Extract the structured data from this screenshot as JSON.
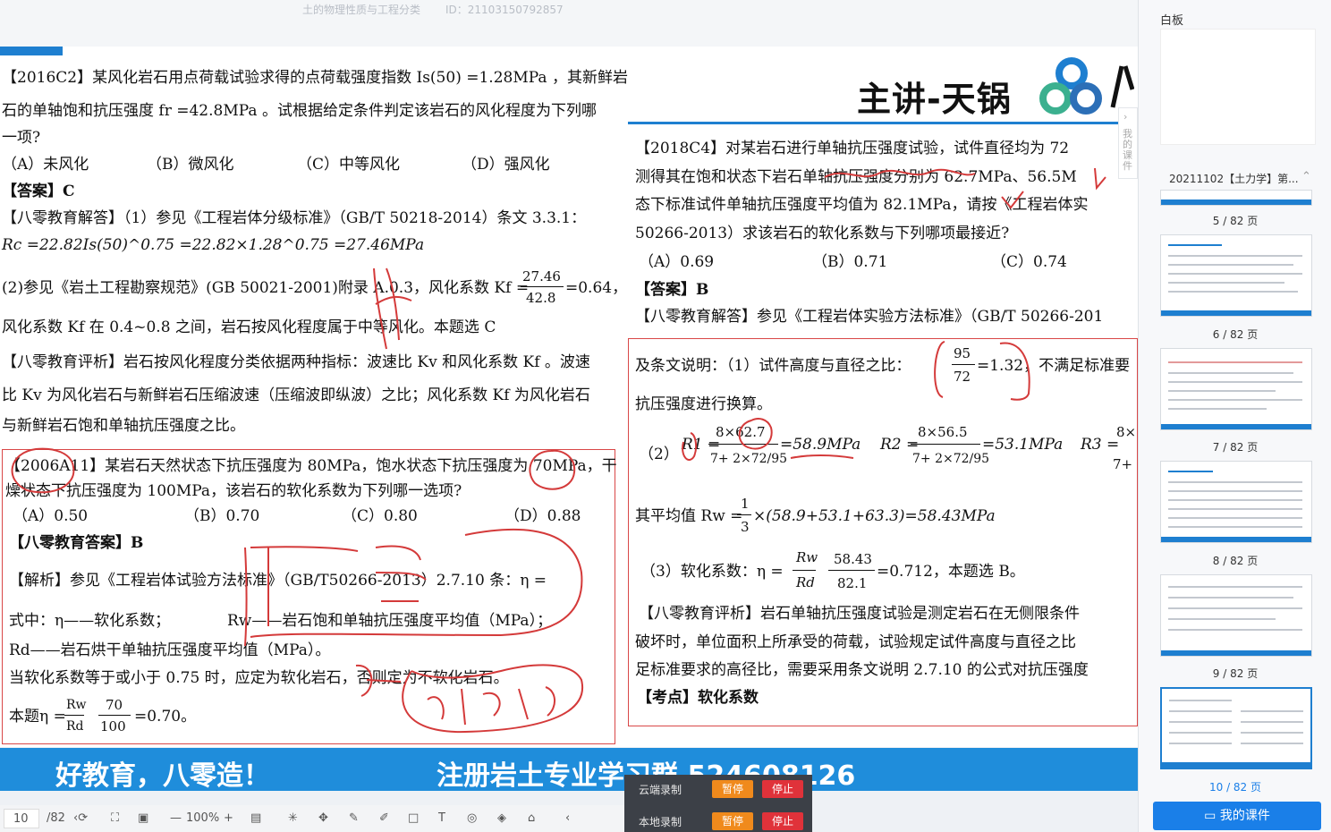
{
  "top": {
    "title": "土的物理性质与工程分类",
    "id": "ID：21103150792857"
  },
  "teacher": "主讲-天锅",
  "left": {
    "q1_l1": "【2016C2】某风化岩石用点荷载试验求得的点荷载强度指数 Is(50) =1.28MPa ，其新鲜岩",
    "q1_l2": "石的单轴饱和抗压强度 fr =42.8MPa 。试根据给定条件判定该岩石的风化程度为下列哪",
    "q1_l3": "一项?",
    "q1_a": "（A）未风化",
    "q1_b": "（B）微风化",
    "q1_c": "（C）中等风化",
    "q1_d": "（D）强风化",
    "q1_ans": "【答案】C",
    "q1_exp1": "【八零教育解答】（1）参见《工程岩体分级标准》（GB/T 50218-2014）条文 3.3.1：",
    "q1_exp2": "Rc =22.82Is(50)^0.75 =22.82×1.28^0.75 =27.46MPa",
    "q1_exp3": "(2)参见《岩土工程勘察规范》(GB 50021-2001)附录 A.0.3，风化系数 Kf =",
    "q1_frac_num": "27.46",
    "q1_frac_den": "42.8",
    "q1_frac_res": "=0.64，",
    "q1_exp4": "风化系数 Kf 在 0.4~0.8 之间，岩石按风化程度属于中等风化。本题选 C",
    "q1_rev1": "【八零教育评析】岩石按风化程度分类依据两种指标：波速比 Kv 和风化系数 Kf 。波速",
    "q1_rev2": "比 Kv 为风化岩石与新鲜岩石压缩波速（压缩波即纵波）之比；风化系数 Kf 为风化岩石",
    "q1_rev3": "与新鲜岩石饱和单轴抗压强度之比。",
    "q2_l1": "【2006A11】某岩石天然状态下抗压强度为 80MPa，饱水状态下抗压强度为 70MPa，干",
    "q2_l2": "燥状态下抗压强度为 100MPa，该岩石的软化系数为下列哪一选项?",
    "q2_a": "（A）0.50",
    "q2_b": "（B）0.70",
    "q2_c": "（C）0.80",
    "q2_d": "（D）0.88",
    "q2_ans": "【八零教育答案】B",
    "q2_exp1": "【解析】参见《工程岩体试验方法标准》（GB/T50266-2013）2.7.10 条：η =",
    "q2_exp2": "式中：η——软化系数；",
    "q2_exp2b": "Rw——岩石饱和单轴抗压强度平均值（MPa）；",
    "q2_exp3": "Rd——岩石烘干单轴抗压强度平均值（MPa）。",
    "q2_exp4": "当软化系数等于或小于 0.75 时，应定为软化岩石，否则定为不软化岩石。",
    "q2_exp5": "本题η =",
    "q2_f1n": "Rw",
    "q2_f1d": "Rd",
    "q2_f2n": "70",
    "q2_f2d": "100",
    "q2_res": "=0.70。"
  },
  "right": {
    "l1": "【2018C4】对某岩石进行单轴抗压强度试验，试件直径均为 72",
    "l2": "测得其在饱和状态下岩石单轴抗压强度分别为 62.7MPa、56.5M",
    "l3": "态下标准试件单轴抗压强度平均值为 82.1MPa，请按《工程岩体实",
    "l4": "50266-2013）求该岩石的软化系数与下列哪项最接近?",
    "a": "（A）0.69",
    "b": "（B）0.71",
    "c": "（C）0.74",
    "ans": "【答案】B",
    "exp1": "【八零教育解答】参见《工程岩体实验方法标准》（GB/T 50266-201",
    "exp2": "及条文说明：（1）试件高度与直径之比：",
    "exp2_n": "95",
    "exp2_d": "72",
    "exp2_r": "=1.32，不满足标准要",
    "exp3": "抗压强度进行换算。",
    "exp4_lab": "（2）",
    "r1": "R1 =",
    "r1n": "8×62.7",
    "r1d": "7+ 2×72/95",
    "r1r": "=58.9MPa",
    "r2": "R2 =",
    "r2n": "8×56.5",
    "r2d": "7+ 2×72/95",
    "r2r": "=53.1MPa",
    "r3": "R3 =",
    "r3n": "8×",
    "r3d": "7+",
    "avg": "其平均值 Rw =",
    "avg_n": "1",
    "avg_d": "3",
    "avg_r": "×(58.9+53.1+63.3)=58.43MPa",
    "soft": "（3）软化系数：η =",
    "soft_n1": "Rw",
    "soft_d1": "Rd",
    "soft_n2": "58.43",
    "soft_d2": "82.1",
    "soft_r": "=0.712，本题选 B。",
    "rev1": "【八零教育评析】岩石单轴抗压强度试验是测定岩石在无侧限条件",
    "rev2": "破坏时，单位面积上所承受的荷载，试验规定试件高度与直径之比",
    "rev3": "足标准要求的高径比，需要采用条文说明 2.7.10 的公式对抗压强度",
    "kp": "【考点】软化系数"
  },
  "banner": {
    "slogan": "好教育，八零造！",
    "group": "注册岩土专业学习群 524608126"
  },
  "toolbar": {
    "page": "10",
    "total": "/82",
    "zoom": "100%"
  },
  "rec": {
    "cloud": "云端录制",
    "local": "本地录制",
    "pause": "暂停",
    "stop": "停止"
  },
  "sidebar": {
    "whiteboard": "白板",
    "course": "20211102【土力学】第...",
    "sidetab": "我的课件",
    "pages": [
      "5 / 82 页",
      "6 / 82 页",
      "7 / 82 页",
      "8 / 82 页",
      "9 / 82 页",
      "10 / 82 页"
    ],
    "mycourse": "我的课件"
  },
  "colors": {
    "accent": "#1e7fd0",
    "ink": "#d43a3a",
    "pause": "#f08a1c",
    "stop": "#e0323a"
  }
}
